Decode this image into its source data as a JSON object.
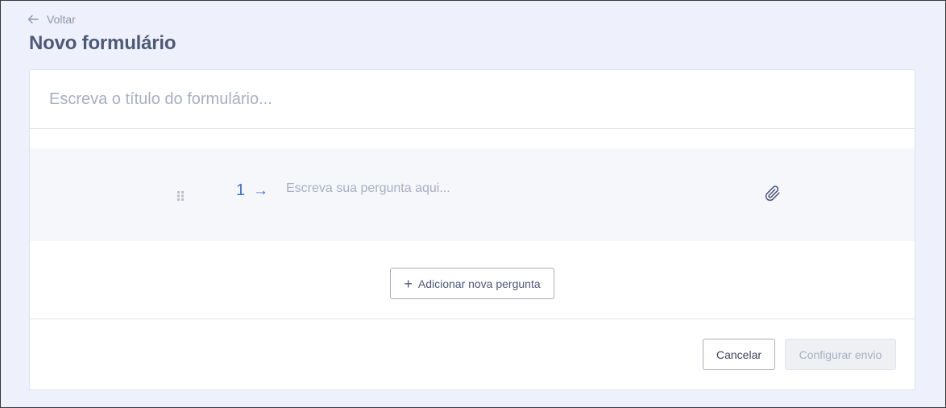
{
  "header": {
    "back_label": "Voltar",
    "back_icon": "arrow-left-icon",
    "title": "Novo formulário"
  },
  "form": {
    "title_placeholder": "Escreva o título do formulário...",
    "title_value": ""
  },
  "questions": [
    {
      "number": "1",
      "arrow": "→",
      "placeholder": "Escreva sua pergunta aqui...",
      "value": "",
      "drag_icon": "drag-handle-icon",
      "attach_icon": "paperclip-icon"
    }
  ],
  "actions": {
    "add_question_label": "Adicionar nova pergunta",
    "add_icon": "+",
    "cancel_label": "Cancelar",
    "configure_label": "Configurar envio"
  },
  "colors": {
    "background": "#eef1fb",
    "title": "#4e5877",
    "accent": "#3d6fd6",
    "placeholder": "#a8afc3"
  }
}
